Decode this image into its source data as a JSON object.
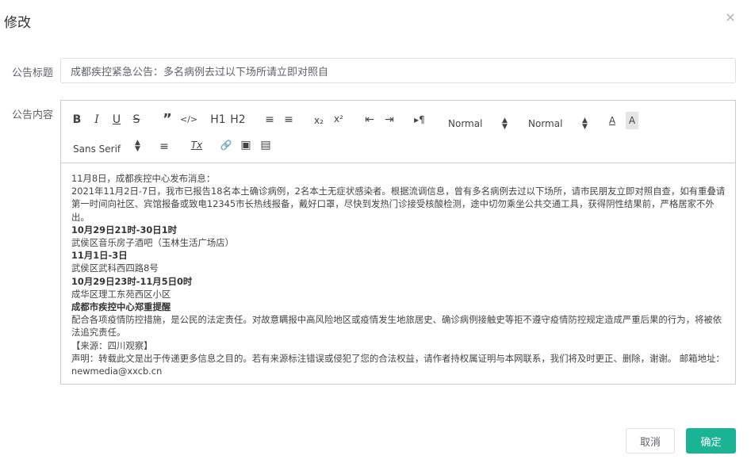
{
  "dialog": {
    "title": "修改",
    "close_icon": "×"
  },
  "form": {
    "title_label": "公告标题",
    "title_value": "成都疾控紧急公告：多名病例去过以下场所请立即对照自",
    "content_label": "公告内容"
  },
  "toolbar": {
    "bold": "B",
    "italic": "I",
    "underline": "U",
    "strike": "S",
    "blockquote": "”",
    "code": "</>",
    "h1": "H1",
    "h2": "H2",
    "ordered_list": "≡",
    "bullet_list": "≡",
    "subscript": "x₂",
    "superscript": "x²",
    "outdent": "⇤",
    "indent": "⇥",
    "direction": "▸¶",
    "size_picker": "Normal",
    "header_picker": "Normal",
    "color": "A",
    "background": "A",
    "font_picker": "Sans Serif",
    "align": "≡",
    "clean": "Tx",
    "link": "🔗",
    "image": "▣",
    "video": "▤"
  },
  "content": {
    "lines": [
      {
        "text": "11月8日，成都疾控中心发布消息：",
        "bold": false
      },
      {
        "text": "2021年11月2日-7日，我市已报告18名本土确诊病例，2名本土无症状感染者。根据流调信息，曾有多名病例去过以下场所，请市民朋友立即对照自查，如有重叠请第一时间向社区、宾馆报备或致电12345市长热线报备，戴好口罩，尽快到发热门诊接受核酸检测，途中切勿乘坐公共交通工具，获得阴性结果前，严格居家不外出。",
        "bold": false
      },
      {
        "text": "10月29日21时-30日1时",
        "bold": true
      },
      {
        "text": "武侯区音乐房子酒吧（玉林生活广场店）",
        "bold": false
      },
      {
        "text": "11月1日-3日",
        "bold": true
      },
      {
        "text": "武侯区武科西四路8号",
        "bold": false
      },
      {
        "text": "10月29日23时-11月5日0时",
        "bold": true
      },
      {
        "text": "成华区理工东苑西区小区",
        "bold": false
      },
      {
        "text": "成都市疾控中心郑重提醒",
        "bold": true
      },
      {
        "text": "配合各项疫情防控措施，是公民的法定责任。对故意瞒报中高风险地区或疫情发生地旅居史、确诊病例接触史等拒不遵守疫情防控规定造成严重后果的行为，将被依法追究责任。",
        "bold": false
      },
      {
        "text": "【来源：四川观察】",
        "bold": false
      },
      {
        "text": "声明：转载此文是出于传递更多信息之目的。若有来源标注错误或侵犯了您的合法权益，请作者持权属证明与本网联系，我们将及时更正、删除，谢谢。 邮箱地址：newmedia@xxcb.cn",
        "bold": false
      }
    ]
  },
  "footer": {
    "cancel": "取消",
    "ok": "确定"
  },
  "colors": {
    "primary": "#1ab394",
    "border": "#dcdfe6"
  }
}
